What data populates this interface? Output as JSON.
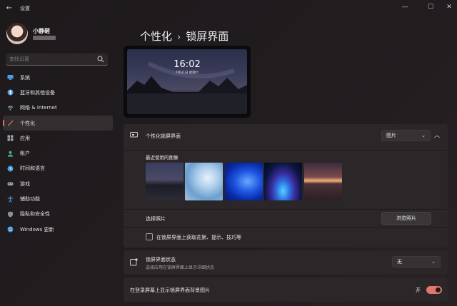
{
  "window": {
    "title": "设置",
    "back": "←",
    "minimize": "—",
    "maximize": "☐",
    "close": "✕"
  },
  "user": {
    "name": "小静砸"
  },
  "search": {
    "placeholder": "查找设置"
  },
  "sidebar": {
    "items": [
      {
        "label": "系统",
        "icon": "monitor-icon",
        "color": "#4a9fe0"
      },
      {
        "label": "蓝牙和其他设备",
        "icon": "bluetooth-icon",
        "color": "#4a9fe0"
      },
      {
        "label": "网络 & Internet",
        "icon": "network-icon",
        "color": "#8fb6d9"
      },
      {
        "label": "个性化",
        "icon": "brush-icon",
        "color": "#e2766a",
        "active": true
      },
      {
        "label": "应用",
        "icon": "apps-icon",
        "color": "#9aa6b5"
      },
      {
        "label": "帐户",
        "icon": "account-icon",
        "color": "#3fb27f"
      },
      {
        "label": "时间和语言",
        "icon": "clock-globe-icon",
        "color": "#4a9fe0"
      },
      {
        "label": "游戏",
        "icon": "gamepad-icon",
        "color": "#9aa6b5"
      },
      {
        "label": "辅助功能",
        "icon": "accessibility-icon",
        "color": "#4aa3e6"
      },
      {
        "label": "隐私和安全性",
        "icon": "shield-icon",
        "color": "#8d8f96"
      },
      {
        "label": "Windows 更新",
        "icon": "update-icon",
        "color": "#3f8fd8"
      }
    ]
  },
  "breadcrumb": {
    "parent": "个性化",
    "separator": "›",
    "current": "锁屏界面"
  },
  "preview": {
    "time": "16:02",
    "date": "7月31日 星期六"
  },
  "personalize": {
    "label": "个性化锁屏界面",
    "value": "图片",
    "recent_label": "最近使用的图像",
    "choose_label": "选择照片",
    "browse_button": "浏览照片",
    "checkbox_label": "在锁屏界面上获取花絮、提示、技巧等",
    "collapse": "︿"
  },
  "status": {
    "label": "锁屏界面状态",
    "sublabel": "选择应用在锁屏界面上显示详细状态",
    "value": "无"
  },
  "signin": {
    "label": "在登录屏幕上显示锁屏界面背景图片",
    "toggle_text": "开",
    "toggle_on": true
  },
  "colors": {
    "accent": "#e2766a"
  }
}
